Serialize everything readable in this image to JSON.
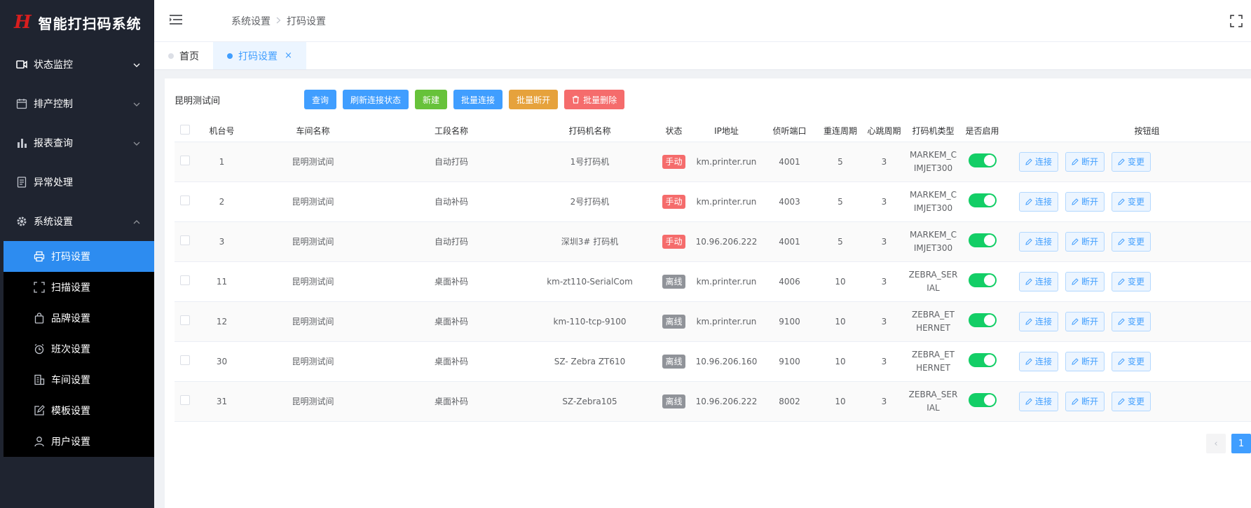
{
  "app": {
    "logo_mark": "H",
    "title": "智能打扫码系统"
  },
  "sidebar": {
    "menus": [
      {
        "label": "状态监控",
        "icon": "video-icon"
      },
      {
        "label": "排产控制",
        "icon": "calendar-icon"
      },
      {
        "label": "报表查询",
        "icon": "bar-chart-icon"
      },
      {
        "label": "异常处理",
        "icon": "document-icon"
      },
      {
        "label": "系统设置",
        "icon": "gear-icon"
      }
    ],
    "sub_items": [
      {
        "label": "打码设置",
        "icon": "printer-icon"
      },
      {
        "label": "扫描设置",
        "icon": "scan-icon"
      },
      {
        "label": "品牌设置",
        "icon": "bag-icon"
      },
      {
        "label": "班次设置",
        "icon": "alarm-clock-icon"
      },
      {
        "label": "车间设置",
        "icon": "building-icon"
      },
      {
        "label": "模板设置",
        "icon": "edit-icon"
      },
      {
        "label": "用户设置",
        "icon": "user-icon"
      }
    ]
  },
  "header": {
    "breadcrumb": [
      "系统设置",
      "打码设置"
    ]
  },
  "tabs": [
    {
      "label": "首页"
    },
    {
      "label": "打码设置",
      "close": "×"
    }
  ],
  "toolbar": {
    "workshop": "昆明测试间",
    "buttons": {
      "query": "查询",
      "refresh": "刷新连接状态",
      "create": "新建",
      "batch_connect": "批量连接",
      "batch_disconnect": "批量断开",
      "batch_delete": "批量删除"
    }
  },
  "table": {
    "headers": [
      "机台号",
      "车间名称",
      "工段名称",
      "打码机名称",
      "状态",
      "IP地址",
      "侦听端口",
      "重连周期",
      "心跳周期",
      "打码机类型",
      "是否启用",
      "按钮组"
    ],
    "action_labels": {
      "connect": "连接",
      "disconnect": "断开",
      "change": "变更"
    },
    "rows": [
      {
        "no": "1",
        "workshop": "昆明测试间",
        "section": "自动打码",
        "printer": "1号打码机",
        "status": "手动",
        "ip": "km.printer.run",
        "port": "4001",
        "reconnect": "5",
        "heartbeat": "3",
        "type": "MARKEM_CIMJET300",
        "enabled": true
      },
      {
        "no": "2",
        "workshop": "昆明测试间",
        "section": "自动补码",
        "printer": "2号打码机",
        "status": "手动",
        "ip": "km.printer.run",
        "port": "4003",
        "reconnect": "5",
        "heartbeat": "3",
        "type": "MARKEM_CIMJET300",
        "enabled": true
      },
      {
        "no": "3",
        "workshop": "昆明测试间",
        "section": "自动打码",
        "printer": "深圳3# 打码机",
        "status": "手动",
        "ip": "10.96.206.222",
        "port": "4001",
        "reconnect": "5",
        "heartbeat": "3",
        "type": "MARKEM_CIMJET300",
        "enabled": true
      },
      {
        "no": "11",
        "workshop": "昆明测试间",
        "section": "桌面补码",
        "printer": "km-zt110-SerialCom",
        "status": "离线",
        "ip": "km.printer.run",
        "port": "4006",
        "reconnect": "10",
        "heartbeat": "3",
        "type": "ZEBRA_SERIAL",
        "enabled": true
      },
      {
        "no": "12",
        "workshop": "昆明测试间",
        "section": "桌面补码",
        "printer": "km-110-tcp-9100",
        "status": "离线",
        "ip": "km.printer.run",
        "port": "9100",
        "reconnect": "10",
        "heartbeat": "3",
        "type": "ZEBRA_ETHERNET",
        "enabled": true
      },
      {
        "no": "30",
        "workshop": "昆明测试间",
        "section": "桌面补码",
        "printer": "SZ- Zebra ZT610",
        "status": "离线",
        "ip": "10.96.206.160",
        "port": "9100",
        "reconnect": "10",
        "heartbeat": "3",
        "type": "ZEBRA_ETHERNET",
        "enabled": true
      },
      {
        "no": "31",
        "workshop": "昆明测试间",
        "section": "桌面补码",
        "printer": "SZ-Zebra105",
        "status": "离线",
        "ip": "10.96.206.222",
        "port": "8002",
        "reconnect": "10",
        "heartbeat": "3",
        "type": "ZEBRA_SERIAL",
        "enabled": true
      }
    ]
  },
  "pagination": {
    "prev": "‹",
    "current": "1"
  },
  "colors": {
    "primary": "#409eff",
    "sidebar_bg": "#1f2430",
    "active_menu": "#2d8cf0",
    "switch_on": "#13ce66",
    "status_manual": "#f56c6c",
    "status_offline": "#909399"
  }
}
